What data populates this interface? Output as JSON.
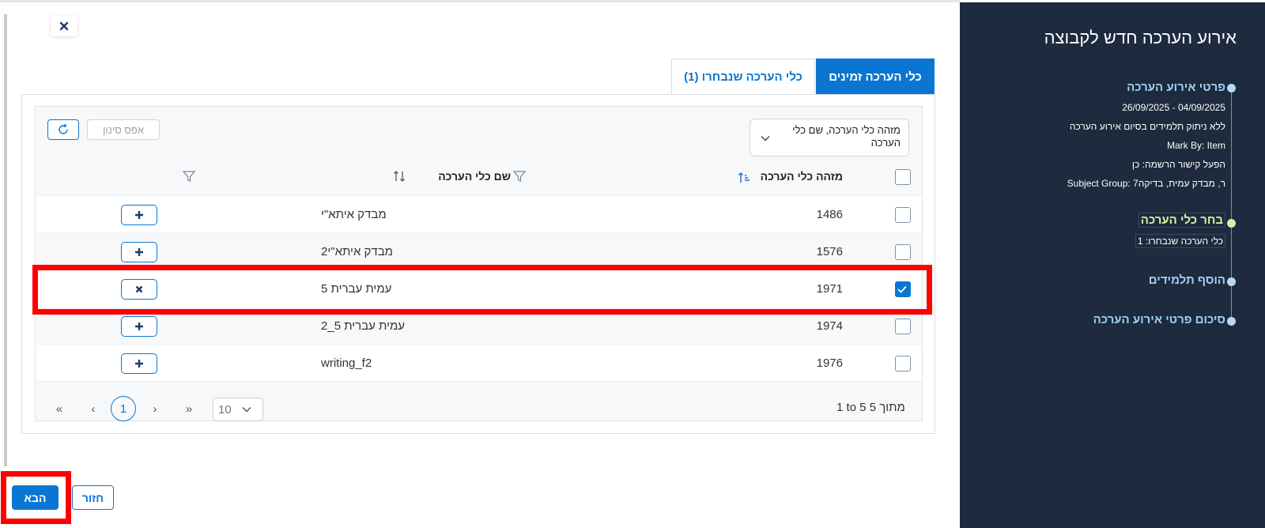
{
  "dialog": {
    "close_label": "×"
  },
  "tabs": [
    {
      "label": "כלי הערכה זמינים",
      "active": true
    },
    {
      "label": "כלי הערכה שנבחרו (1)",
      "active": false
    }
  ],
  "toolbar": {
    "search_field_value": "מזהה כלי הערכה, שם כלי הערכה",
    "reset_filter_label": "אפס סינון",
    "refresh_icon": "refresh-icon"
  },
  "table": {
    "columns": {
      "id": "מזהה כלי הערכה",
      "name": "שם כלי הערכה"
    },
    "rows": [
      {
        "id": "1486",
        "name": "מבדק איתא\"י",
        "checked": false,
        "action": "plus"
      },
      {
        "id": "1576",
        "name": "מבדק איתא\"י2",
        "checked": false,
        "action": "plus"
      },
      {
        "id": "1971",
        "name": "עמית עברית 5",
        "checked": true,
        "action": "remove"
      },
      {
        "id": "1974",
        "name": "עמית עברית 5_2",
        "checked": false,
        "action": "plus"
      },
      {
        "id": "1976",
        "name": "writing_f2",
        "checked": false,
        "action": "plus"
      }
    ]
  },
  "pagination": {
    "summary": "1 to 5 מתוך 5",
    "current_page": "1",
    "per_page": "10",
    "first": "«",
    "prev": "‹",
    "next": "›",
    "last": "»"
  },
  "footer": {
    "next_label": "הבא",
    "back_label": "חזור"
  },
  "sidebar": {
    "title": "אירוע הערכה חדש לקבוצה",
    "steps": [
      {
        "title": "פרטי אירוע הערכה",
        "details": [
          "26/09/2025 - 04/09/2025",
          "ללא ניתוק תלמידים בסיום אירוע הערכה",
          "Mark By: Item",
          "הפעל קישור הרשמה: כן",
          "Subject Group: 7ר, מבדק עמית, בדיקה"
        ]
      },
      {
        "title": "בחר כלי הערכה",
        "details": [
          "כלי הערכה שנבחרו: 1"
        ]
      },
      {
        "title": "הוסף תלמידים",
        "details": []
      },
      {
        "title": "סיכום פרטי אירוע הערכה",
        "details": []
      }
    ],
    "active_step": 1
  },
  "colors": {
    "accent": "#0b76d1",
    "sidebar_bg": "#1e2a3d",
    "highlight": "#ff0000",
    "active_step": "#d8f0a8"
  }
}
